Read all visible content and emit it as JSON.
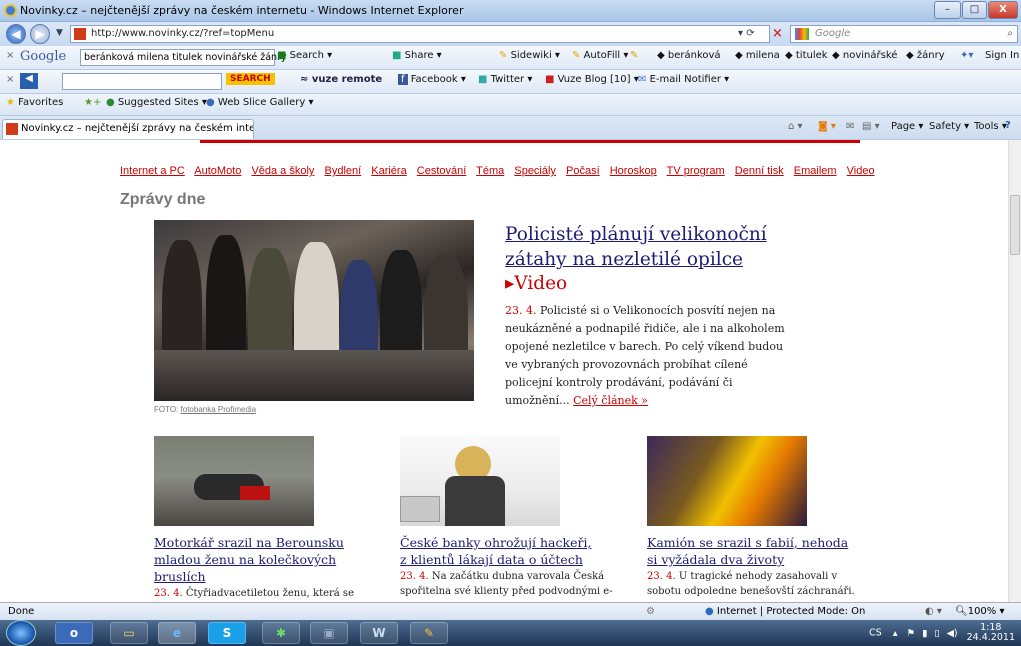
{
  "window": {
    "title": "Novinky.cz – nejčtenější zprávy na českém internetu - Windows Internet Explorer",
    "minimize": "–",
    "maximize": "□",
    "close": "X"
  },
  "address": {
    "url": "http://www.novinky.cz/?ref=topMenu",
    "search_placeholder": "Google"
  },
  "google_toolbar": {
    "brand": "Google",
    "query": "beránková milena titulek novinářské žánry",
    "search": "Search",
    "share": "Share",
    "sidewiki": "Sidewiki",
    "autofill": "AutoFill",
    "highlights": [
      "beránková",
      "milena",
      "titulek",
      "novinářské",
      "žánry"
    ],
    "sign_in": "Sign In"
  },
  "vuze_toolbar": {
    "search": "SEARCH",
    "remote": "vuze remote",
    "facebook": "Facebook",
    "twitter": "Twitter",
    "blog": "Vuze Blog [10]",
    "email": "E-mail Notifier"
  },
  "favorites_bar": {
    "favorites": "Favorites",
    "suggested": "Suggested Sites",
    "gallery": "Web Slice Gallery"
  },
  "tab": {
    "label": "Novinky.cz – nejčtenější zprávy na českém intern..."
  },
  "command_bar": {
    "page": "Page",
    "safety": "Safety",
    "tools": "Tools"
  },
  "nav": [
    "Internet a PC",
    "AutoMoto",
    "Věda a školy",
    "Bydlení",
    "Kariéra",
    "Cestování",
    "Téma",
    "Speciály",
    "Počasí",
    "Horoskop",
    "TV program",
    "Denní tisk",
    "Emailem",
    "Video"
  ],
  "section_title": "Zprávy dne",
  "main_article": {
    "headline": "Policisté plánují velikonoční zátahy na nezletilé opilce",
    "video": "▸Video",
    "date": "23. 4.",
    "body": "Policisté si o Velikonocích posvítí nejen na neukázněné a podnapilé řidiče, ale i na alkoholem opojené nezletilce v barech. Po celý víkend budou ve vybraných provozovnách probíhat cílené policejní kontroly prodávání, podávání či umožnění...",
    "more": "Celý článek »",
    "caption_prefix": "FOTO:",
    "caption_source": "fotobanka Profimedia"
  },
  "articles": [
    {
      "headline": "Motorkář srazil na Berounsku mladou ženu na kolečkových bruslích",
      "date": "23. 4.",
      "body": "Čtyřiadvacetiletou ženu, která se"
    },
    {
      "headline": "České banky ohrožují hackeři, z klientů lákají data o účtech",
      "date": "23. 4.",
      "body": "Na začátku dubna varovala Česká spořitelna své klienty před podvodnými e-"
    },
    {
      "headline": "Kamión se srazil s fabií, nehoda si vyžádala dva životy",
      "date": "23. 4.",
      "body": "U tragické nehody zasahovali v sobotu odpoledne benešovští záchranáři."
    }
  ],
  "status": {
    "text": "Done",
    "zone": "Internet | Protected Mode: On",
    "zoom": "100%"
  },
  "taskbar": {
    "lang": "CS",
    "time": "1:18",
    "date": "24.4.2011"
  }
}
